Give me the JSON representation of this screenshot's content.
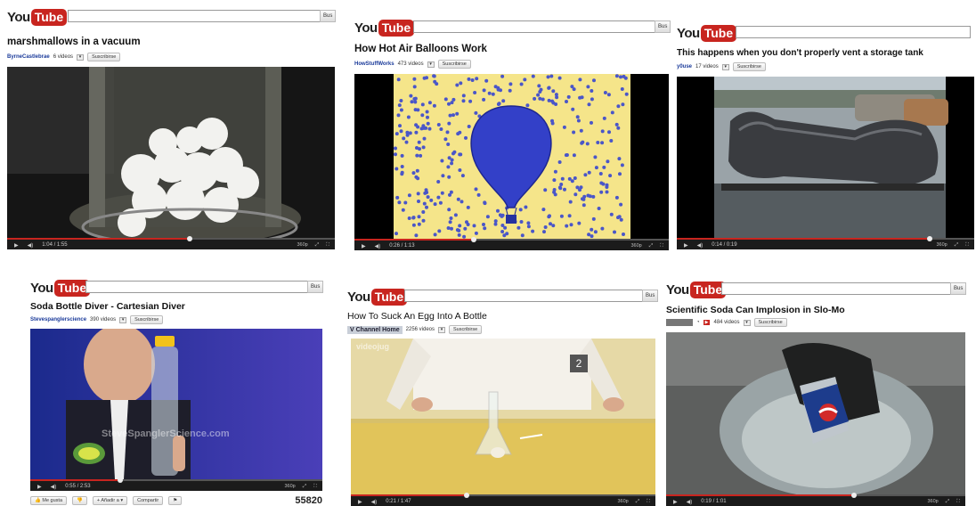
{
  "logo": {
    "you": "You",
    "tube": "Tube"
  },
  "search_button": "Bus",
  "panels": [
    {
      "title": "marshmallows in a vacuum",
      "channel": "ByrneCastlebrae",
      "videos": "6 videos",
      "subscribe": "Suscribirse",
      "time": "1:04 / 1:55",
      "progress": 0.55
    },
    {
      "title": "How Hot Air Balloons Work",
      "channel": "HowStuffWorks",
      "videos": "473 videos",
      "subscribe": "Suscribirse",
      "time": "0:26 / 1:13",
      "progress": 0.37
    },
    {
      "title": "This happens when you don't properly vent a storage tank",
      "channel": "y0use",
      "videos": "17 videos",
      "subscribe": "Suscribirse",
      "time": "0:14 / 0:19",
      "progress": 0.84
    },
    {
      "title": "Soda Bottle Diver - Cartesian Diver",
      "channel": "Stevespanglerscience",
      "videos": "390 videos",
      "subscribe": "Suscribirse",
      "time": "0:55 / 2:53",
      "progress": 0.3,
      "watermark": "SteveSpanglerScience.com",
      "like": "Me gusta",
      "add": "Añadir a",
      "share": "Compartir",
      "views": "55820"
    },
    {
      "title": "How To Suck An Egg Into A Bottle",
      "channel": "Channel Home",
      "videos": "2256 videos",
      "subscribe": "Suscribirse",
      "time": "0:21 / 1:47",
      "progress": 0.37,
      "badge": "2",
      "watermark": "videojug"
    },
    {
      "title": "Scientific Soda Can Implosion in Slo-Mo",
      "channel": "",
      "videos": "484 videos",
      "subscribe": "Suscribirse",
      "time": "0:19 / 1:01",
      "progress": 0.62
    }
  ],
  "quality": "360p"
}
